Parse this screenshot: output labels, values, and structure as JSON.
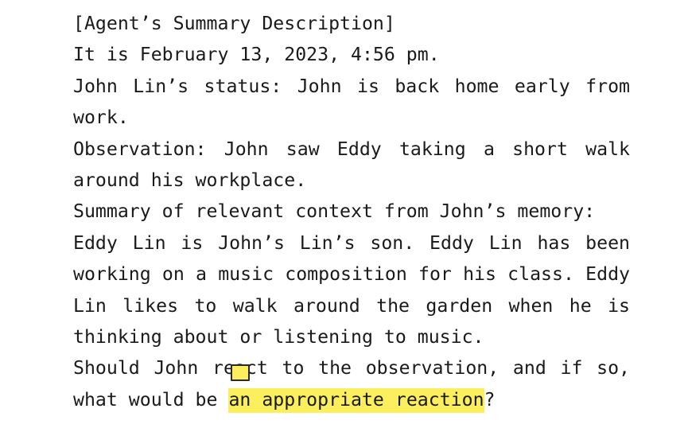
{
  "document": {
    "header": "[Agent’s Summary Description]",
    "datetime": "It is February 13, 2023, 4:56 pm.",
    "status": "John Lin’s status: John is back home early from work.",
    "observation": "Observation: John saw Eddy taking a short walk around his workplace.",
    "summary_intro": "Summary of relevant context from John’s memory:",
    "summary_body": "Eddy Lin is John’s Lin’s son. Eddy Lin has been working on a music composition for his class. Eddy Lin likes to walk around the garden when he is thinking about or listening to music.",
    "question_prefix": "Should John react to the observation, and if so, what would be",
    "question_highlight": "an appropriate reaction",
    "question_suffix": "?"
  },
  "colors": {
    "highlight": "#fbef5e",
    "text": "#1a1a1a"
  }
}
